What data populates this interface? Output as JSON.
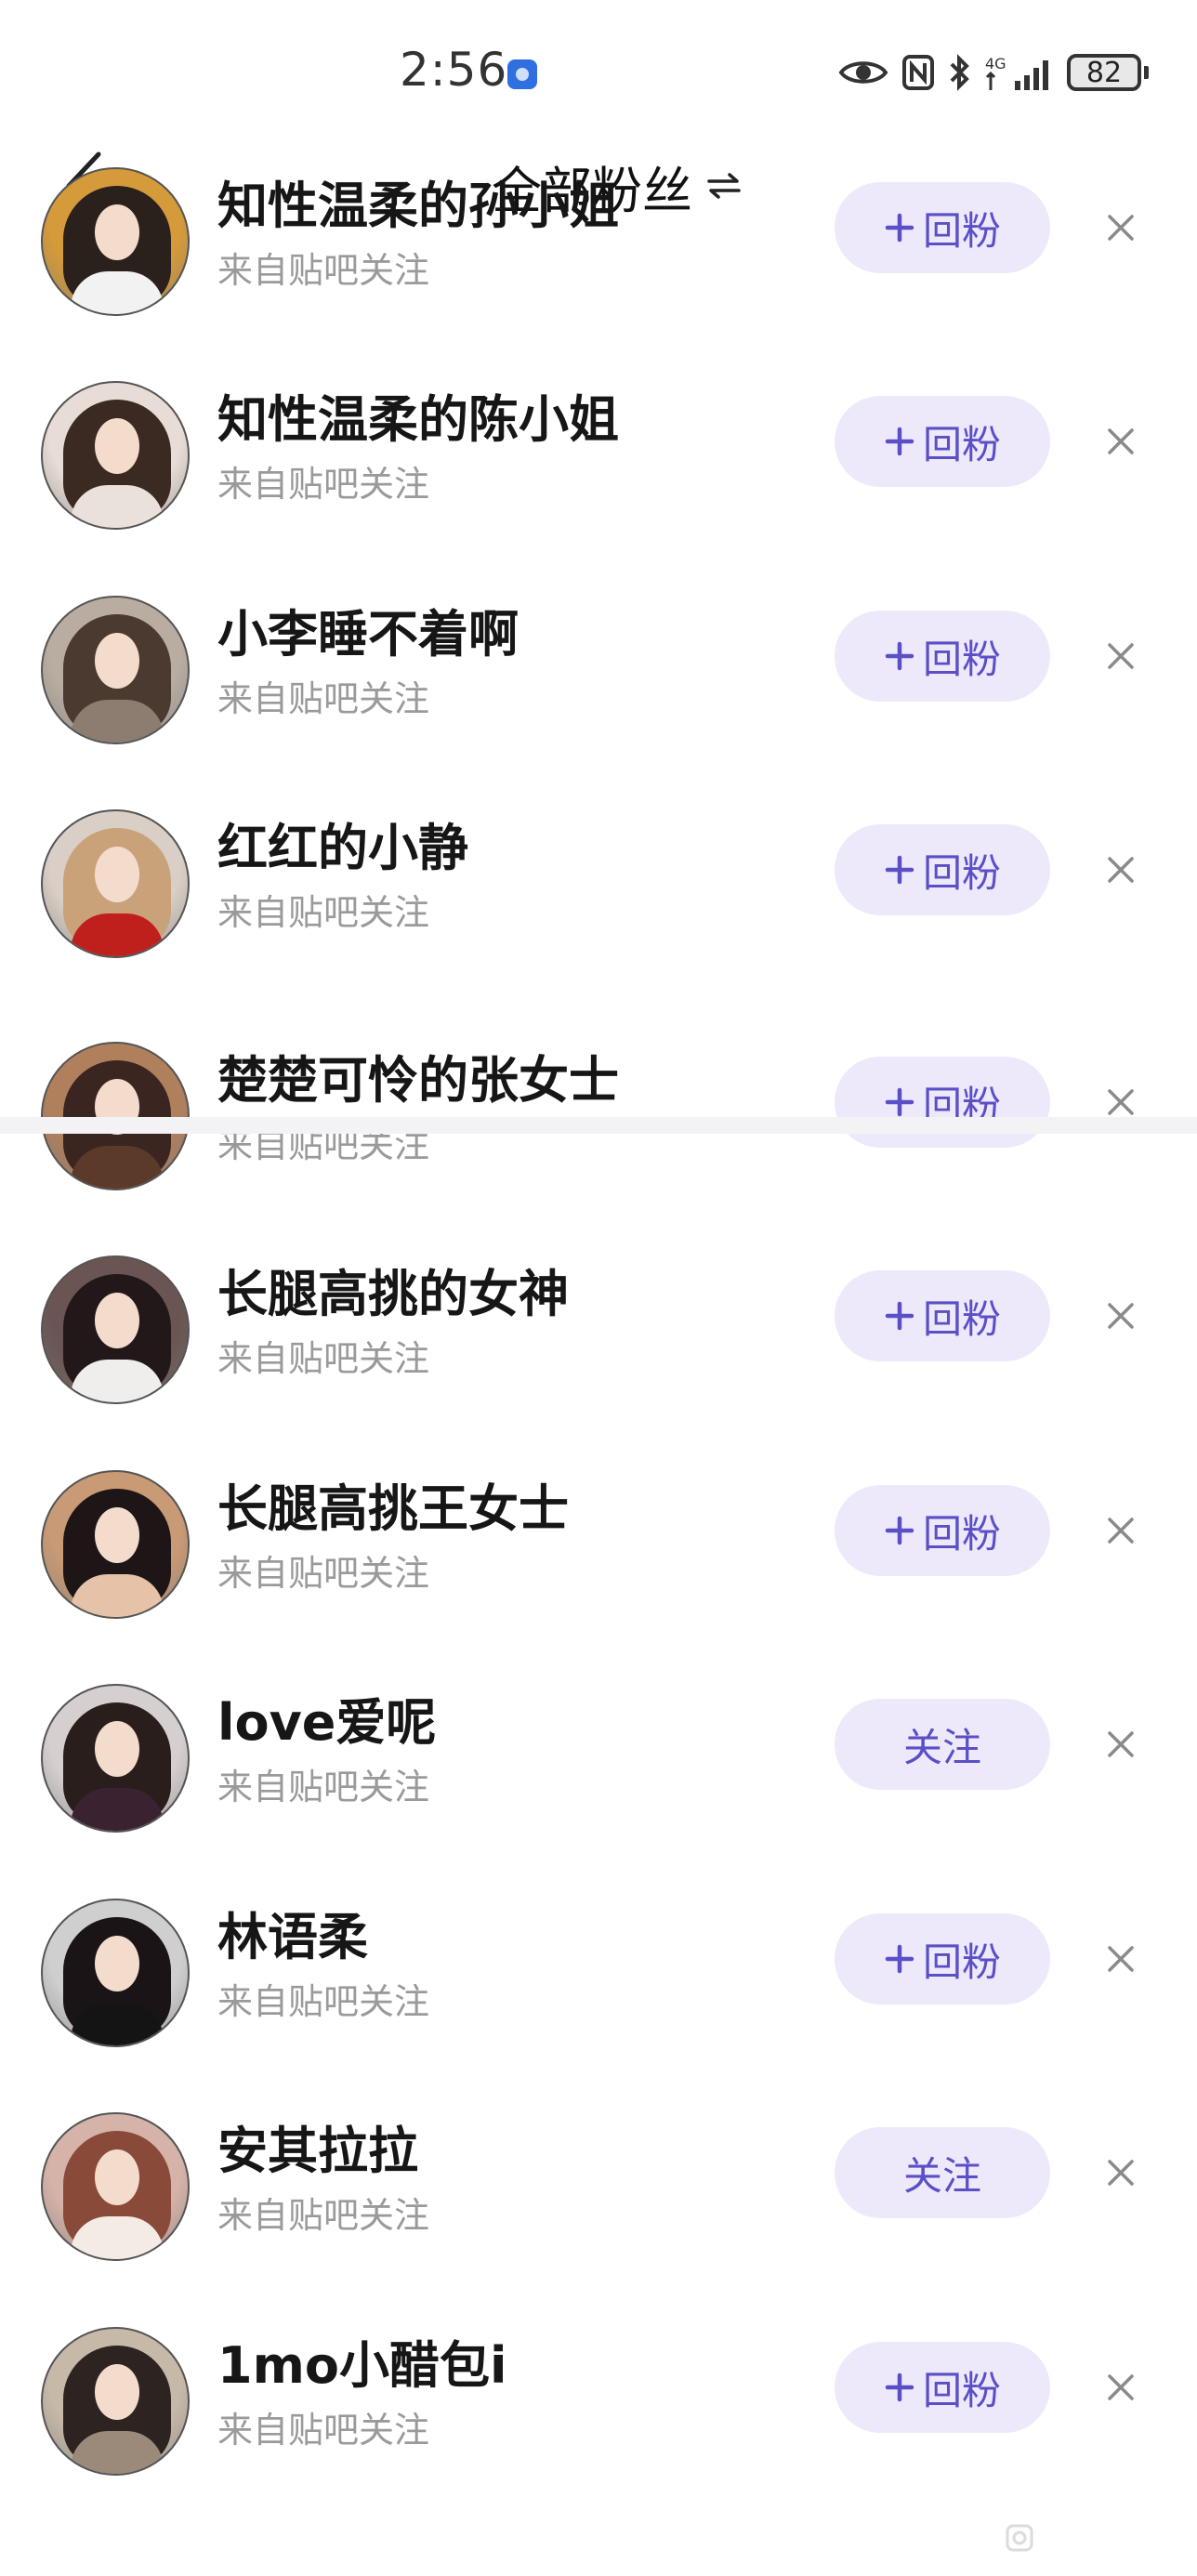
{
  "status_bar": {
    "time": "2:56",
    "network_label": "4G",
    "battery": "82",
    "icons": [
      "app-notification-icon",
      "eye-icon",
      "nfc-icon",
      "bluetooth-icon",
      "signal-icon",
      "battery-icon"
    ]
  },
  "header": {
    "title": "全部粉丝",
    "back_icon": "chevron-left-icon",
    "swap_icon": "swap-icon"
  },
  "fans": [
    {
      "name": "知性温柔的孙小姐",
      "source": "来自贴吧关注",
      "action": "回粉",
      "action_icon": "plus-icon",
      "avatar_hair": "#2b211c",
      "avatar_bg": "#d59a3a",
      "avatar_body": "#f2f2f2"
    },
    {
      "name": "知性温柔的陈小姐",
      "source": "来自贴吧关注",
      "action": "回粉",
      "action_icon": "plus-icon",
      "avatar_hair": "#3a2a22",
      "avatar_bg": "#e8ddd6",
      "avatar_body": "#e9e1da"
    },
    {
      "name": "小李睡不着啊",
      "source": "来自贴吧关注",
      "action": "回粉",
      "action_icon": "plus-icon",
      "avatar_hair": "#4a3a30",
      "avatar_bg": "#b9ada2",
      "avatar_body": "#8c7d70"
    },
    {
      "name": "红红的小静",
      "source": "来自贴吧关注",
      "action": "回粉",
      "action_icon": "plus-icon",
      "avatar_hair": "#c9a27a",
      "avatar_bg": "#d9cfc6",
      "avatar_body": "#c0201c"
    },
    {
      "name": "楚楚可怜的张女士",
      "source": "来自贴吧关注",
      "action": "回粉",
      "action_icon": "plus-icon",
      "avatar_hair": "#3b2520",
      "avatar_bg": "#b0805d",
      "avatar_body": "#5b3a2a"
    },
    {
      "name": "长腿高挑的女神",
      "source": "来自贴吧关注",
      "action": "回粉",
      "action_icon": "plus-icon",
      "avatar_hair": "#22181a",
      "avatar_bg": "#6a5552",
      "avatar_body": "#f0eeec"
    },
    {
      "name": "长腿高挑王女士",
      "source": "来自贴吧关注",
      "action": "回粉",
      "action_icon": "plus-icon",
      "avatar_hair": "#1e1616",
      "avatar_bg": "#c99a76",
      "avatar_body": "#e6c3a8"
    },
    {
      "name": "love爱呢",
      "source": "来自贴吧关注",
      "action": "关注",
      "action_icon": "",
      "avatar_hair": "#2a1e1c",
      "avatar_bg": "#d6cfcf",
      "avatar_body": "#3a2230"
    },
    {
      "name": "林语柔",
      "source": "来自贴吧关注",
      "action": "回粉",
      "action_icon": "plus-icon",
      "avatar_hair": "#1a1416",
      "avatar_bg": "#cfcfcf",
      "avatar_body": "#141414"
    },
    {
      "name": "安其拉拉",
      "source": "来自贴吧关注",
      "action": "关注",
      "action_icon": "",
      "avatar_hair": "#8a4a3a",
      "avatar_bg": "#d6b3a8",
      "avatar_body": "#f4ece4"
    },
    {
      "name": "1mo小醋包i",
      "source": "来自贴吧关注",
      "action": "回粉",
      "action_icon": "plus-icon",
      "avatar_hair": "#2d2422",
      "avatar_bg": "#c7b9a8",
      "avatar_body": "#9b8a7a"
    }
  ],
  "dismiss_icon": "close-icon",
  "colors": {
    "accent": "#5a4fc6",
    "button_bg": "#ede9fb",
    "secondary_text": "#9a9a9a",
    "divider": "#f3f3f5"
  }
}
